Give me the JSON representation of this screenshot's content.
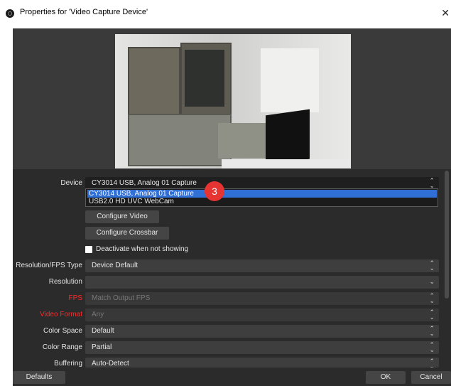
{
  "window": {
    "title": "Properties for 'Video Capture Device'",
    "close_glyph": "✕"
  },
  "device": {
    "label": "Device",
    "value": "CY3014 USB, Analog 01 Capture",
    "options": [
      "CY3014 USB, Analog 01 Capture",
      "USB2.0 HD UVC WebCam"
    ],
    "annotation": "3"
  },
  "buttons": {
    "configure_video": "Configure Video",
    "configure_crossbar": "Configure Crossbar",
    "defaults": "Defaults",
    "ok": "OK",
    "cancel": "Cancel"
  },
  "deactivate": {
    "label": "Deactivate when not showing",
    "checked": false
  },
  "settings": {
    "resolution_fps_type": {
      "label": "Resolution/FPS Type",
      "value": "Device Default"
    },
    "resolution": {
      "label": "Resolution",
      "value": ""
    },
    "fps": {
      "label": "FPS",
      "value": "Match Output FPS"
    },
    "video_format": {
      "label": "Video Format",
      "value": "Any"
    },
    "color_space": {
      "label": "Color Space",
      "value": "Default"
    },
    "color_range": {
      "label": "Color Range",
      "value": "Partial"
    },
    "buffering": {
      "label": "Buffering",
      "value": "Auto-Detect"
    }
  },
  "icons": {
    "app": "obs-logo-icon",
    "spin": "spin-arrows-icon",
    "chevron": "chevron-down-icon"
  },
  "colors": {
    "dialog_bg": "#2b2b2b",
    "selection": "#2f6fd6",
    "disabled_label": "#ff2a2a",
    "badge": "#e53431"
  }
}
